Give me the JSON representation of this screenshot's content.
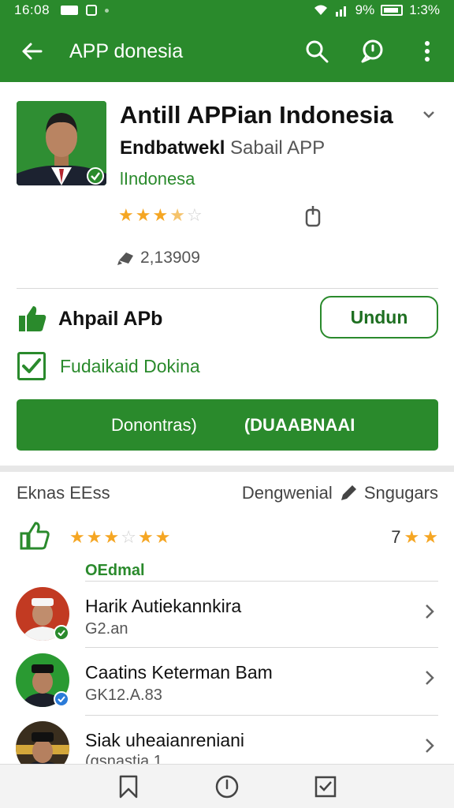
{
  "status_bar": {
    "time": "16:08",
    "battery_text": "9%",
    "clock_right": "1:3%"
  },
  "app_bar": {
    "title": "APP donesia"
  },
  "app": {
    "title": "Antill APPian Indonesia",
    "developer_bold": "Endbatwekl",
    "developer_light": "Sabail APP",
    "country": "lIndonesa",
    "rating_stars": 3.5,
    "downloads": "2,13909"
  },
  "actions": {
    "like_label": "Ahpail APb",
    "install_label": "Undun",
    "checkbox_label": "Fudaikaid Dokina",
    "big_button_left": "Donontras)",
    "big_button_right": "(DUAABNAAI"
  },
  "reviews": {
    "header_left": "Eknas EEss",
    "header_mid": "Dengwenial",
    "header_right": "Sngugars",
    "tail_text": "7",
    "section_label": "OEdmal",
    "items": [
      {
        "name": "Harik Autiekannkira",
        "sub": "G2.an"
      },
      {
        "name": "Caatins Keterman Bam",
        "sub": "GK12.A.83"
      },
      {
        "name": "Siak uheaianreniani",
        "sub": "(gsnastia 1"
      }
    ]
  },
  "colors": {
    "primary": "#2a8a2c",
    "star": "#f5a623"
  }
}
